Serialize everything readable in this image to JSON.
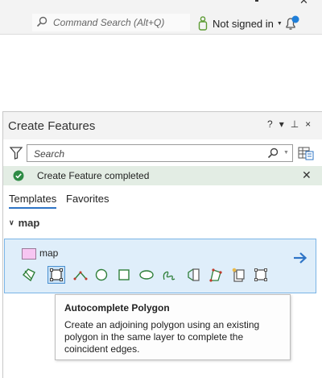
{
  "topbar": {
    "command_search_placeholder": "Command Search (Alt+Q)",
    "signin_label": "Not signed in"
  },
  "pane": {
    "title": "Create Features",
    "controls": {
      "help": "?",
      "menu": "▾",
      "pin": "⊥",
      "close": "×"
    },
    "search_placeholder": "Search",
    "notification": "Create Feature completed",
    "tabs": [
      {
        "label": "Templates",
        "active": true
      },
      {
        "label": "Favorites",
        "active": false
      }
    ],
    "group_name": "map",
    "template": {
      "name": "map",
      "swatch_color": "#f7c6f2",
      "tools": [
        {
          "name": "polygon-tool-icon",
          "active": false
        },
        {
          "name": "autocomplete-polygon-tool-icon",
          "active": true
        },
        {
          "name": "right-angle-polygon-tool-icon",
          "active": false
        },
        {
          "name": "circle-tool-icon",
          "active": false
        },
        {
          "name": "rectangle-tool-icon",
          "active": false
        },
        {
          "name": "ellipse-tool-icon",
          "active": false
        },
        {
          "name": "freehand-tool-icon",
          "active": false
        },
        {
          "name": "split-polygon-tool-icon",
          "active": false
        },
        {
          "name": "trace-tool-icon",
          "active": false
        },
        {
          "name": "auto-close-tool-icon",
          "active": false
        },
        {
          "name": "square-polygon-tool-icon",
          "active": false
        }
      ]
    }
  },
  "tooltip": {
    "title": "Autocomplete Polygon",
    "body": "Create an adjoining polygon using an existing polygon in the same layer to complete the coincident edges."
  },
  "colors": {
    "accent": "#2e74c6",
    "notification_bg": "#e3ede4",
    "success_icon": "#2e8b45",
    "template_selected_bg": "#dfeefa"
  }
}
